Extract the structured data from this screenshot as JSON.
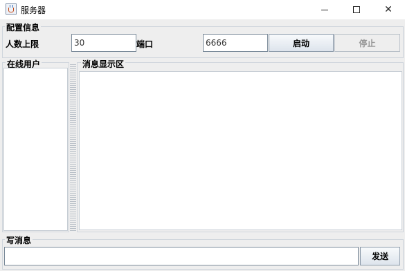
{
  "window": {
    "title": "服务器"
  },
  "config": {
    "group_label": "配置信息",
    "max_users_label": "人数上限",
    "max_users_value": "30",
    "port_label": "端口",
    "port_value": "6666",
    "start_label": "启动",
    "stop_label": "停止"
  },
  "online": {
    "group_label": "在线用户"
  },
  "messages": {
    "group_label": "消息显示区"
  },
  "compose": {
    "group_label": "写消息",
    "input_value": "",
    "send_label": "发送"
  }
}
